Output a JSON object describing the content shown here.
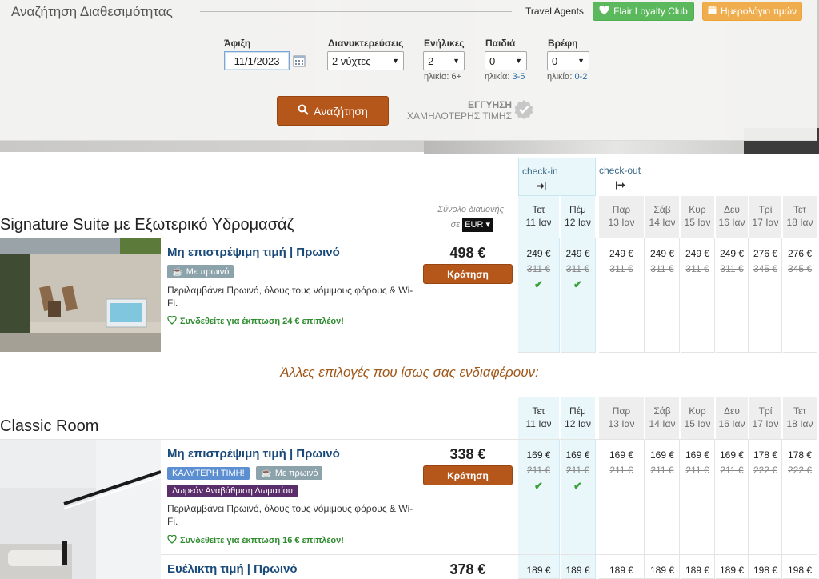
{
  "search": {
    "title": "Αναζήτηση Διαθεσιμότητας",
    "travel_agents": "Travel Agents",
    "loyalty_button": "Flair Loyalty Club",
    "calendar_button": "Ημερολόγιο τιμών",
    "arrival_label": "Άφιξη",
    "arrival_value": "11/1/2023",
    "nights_label": "Διανυκτερεύσεις",
    "nights_value": "2 νύχτες",
    "adults_label": "Ενήλικες",
    "adults_value": "2",
    "adults_hint": "ηλικία: 6+",
    "children_label": "Παιδιά",
    "children_value": "0",
    "children_hint_prefix": "ηλικία:",
    "children_hint_range": "3-5",
    "infants_label": "Βρέφη",
    "infants_value": "0",
    "infants_hint_prefix": "ηλικία:",
    "infants_hint_range": "0-2",
    "search_button": "Αναζήτηση",
    "guarantee_line1": "ΕΓΓΥΗΣΗ",
    "guarantee_line2": "ΧΑΜΗΛΟΤΕΡΗΣ ΤΙΜΗΣ"
  },
  "calendar_header": {
    "checkin": "check-in",
    "checkout": "check-out",
    "days": [
      {
        "dow": "Τετ",
        "date": "11 Ιαν"
      },
      {
        "dow": "Πέμ",
        "date": "12 Ιαν"
      },
      {
        "dow": "Παρ",
        "date": "13 Ιαν"
      },
      {
        "dow": "Σάβ",
        "date": "14 Ιαν"
      },
      {
        "dow": "Κυρ",
        "date": "15 Ιαν"
      },
      {
        "dow": "Δευ",
        "date": "16 Ιαν"
      },
      {
        "dow": "Τρί",
        "date": "17 Ιαν"
      },
      {
        "dow": "Τετ",
        "date": "18 Ιαν"
      }
    ]
  },
  "total_label": "Σύνολο διαμονής",
  "total_in": "σε",
  "currency": "EUR",
  "rooms": [
    {
      "title": "Signature Suite με Εξωτερικό Υδρομασάζ",
      "rates": [
        {
          "name": "Μη επιστρέψιμη τιμή | Πρωινό",
          "tags": [
            "Με πρωινό"
          ],
          "description": "Περιλαμβάνει Πρωινό, όλους τους νόμιμους φόρους & Wi-Fi.",
          "promo": "Συνδεθείτε για έκπτωση 24 € επιπλέον!",
          "total": "498 €",
          "book": "Κράτηση",
          "days": [
            {
              "price": "249 €",
              "old": "311 €"
            },
            {
              "price": "249 €",
              "old": "311 €"
            },
            {
              "price": "249 €",
              "old": "311 €"
            },
            {
              "price": "249 €",
              "old": "311 €"
            },
            {
              "price": "249 €",
              "old": "311 €"
            },
            {
              "price": "249 €",
              "old": "311 €"
            },
            {
              "price": "276 €",
              "old": "345 €"
            },
            {
              "price": "276 €",
              "old": "345 €"
            }
          ]
        }
      ]
    },
    {
      "title": "Classic Room",
      "rates": [
        {
          "name": "Μη επιστρέψιμη τιμή | Πρωινό",
          "tags": [
            "ΚΑΛΥΤΕΡΗ ΤΙΜΗ!",
            "Με πρωινό",
            "Δωρεάν Αναβάθμιση Δωματίου"
          ],
          "description": "Περιλαμβάνει Πρωινό, όλους τους νόμιμους φόρους & Wi-Fi.",
          "promo": "Συνδεθείτε για έκπτωση 16 € επιπλέον!",
          "total": "338 €",
          "book": "Κράτηση",
          "days": [
            {
              "price": "169 €",
              "old": "211 €"
            },
            {
              "price": "169 €",
              "old": "211 €"
            },
            {
              "price": "169 €",
              "old": "211 €"
            },
            {
              "price": "169 €",
              "old": "211 €"
            },
            {
              "price": "169 €",
              "old": "211 €"
            },
            {
              "price": "169 €",
              "old": "211 €"
            },
            {
              "price": "178 €",
              "old": "222 €"
            },
            {
              "price": "178 €",
              "old": "222 €"
            }
          ]
        },
        {
          "name": "Ευέλικτη τιμή | Πρωινό",
          "total": "378 €",
          "days": [
            {
              "price": "189 €"
            },
            {
              "price": "189 €"
            },
            {
              "price": "189 €"
            },
            {
              "price": "189 €"
            },
            {
              "price": "189 €"
            },
            {
              "price": "189 €"
            },
            {
              "price": "198 €"
            },
            {
              "price": "198 €"
            }
          ]
        }
      ]
    }
  ],
  "other_options": "Άλλες επιλογές που ίσως σας ενδιαφέρουν:"
}
